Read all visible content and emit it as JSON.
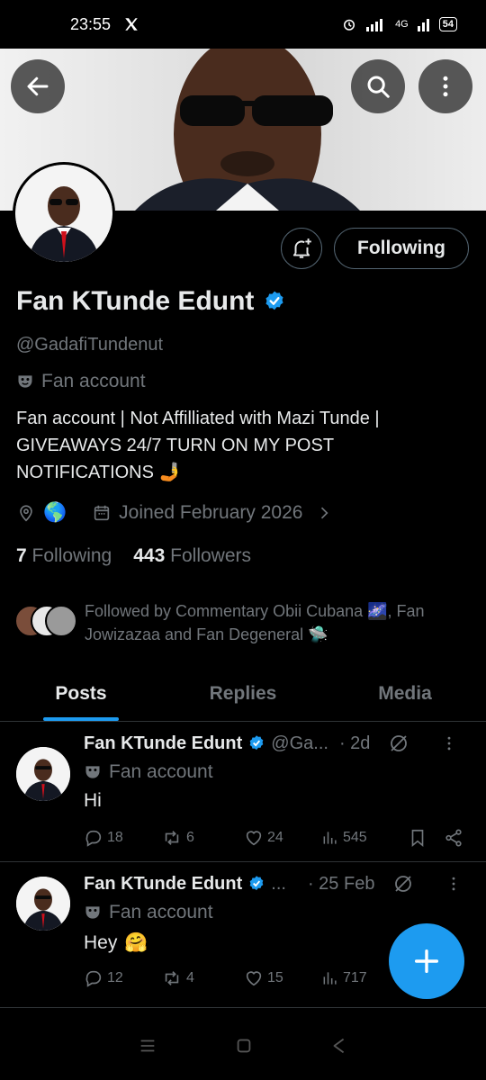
{
  "status_bar": {
    "time": "23:55",
    "app_icon": "x-logo-icon",
    "network": "4G",
    "battery": "54"
  },
  "header": {
    "back_icon": "arrow-left-icon",
    "search_icon": "search-icon",
    "more_icon": "more-vertical-icon"
  },
  "profile": {
    "name": "Fan KTunde Edunt",
    "handle": "@GadafiTundenut",
    "category": "Fan account",
    "bio": "Fan account | Not Affilliated with Mazi Tunde | GIVEAWAYS 24/7  TURN ON MY POST NOTIFICATIONS 🤳",
    "location": "🌎",
    "joined": "Joined February 2026",
    "following_count": "7",
    "following_label": "Following",
    "followers_count": "443",
    "followers_label": "Followers",
    "follow_button": "Following",
    "followed_by": "Followed by Commentary Obii Cubana 🌌, Fan Jowizazaa and Fan Degeneral 🛸"
  },
  "tabs": [
    {
      "label": "Posts",
      "active": true
    },
    {
      "label": "Replies",
      "active": false
    },
    {
      "label": "Media",
      "active": false
    }
  ],
  "posts": [
    {
      "name": "Fan KTunde Edunt",
      "handle": "@Ga...",
      "time": "· 2d",
      "category": "Fan account",
      "text": "Hi",
      "emoji": "",
      "replies": "18",
      "reposts": "6",
      "likes": "24",
      "views": "545"
    },
    {
      "name": "Fan KTunde Edunt",
      "handle": "...",
      "time": "· 25 Feb",
      "category": "Fan account",
      "text": "Hey",
      "emoji": "🤗",
      "replies": "12",
      "reposts": "4",
      "likes": "15",
      "views": "717"
    }
  ],
  "colors": {
    "accent": "#1d9bf0",
    "muted": "#71767b",
    "text": "#e7e9ea",
    "background": "#000000"
  }
}
